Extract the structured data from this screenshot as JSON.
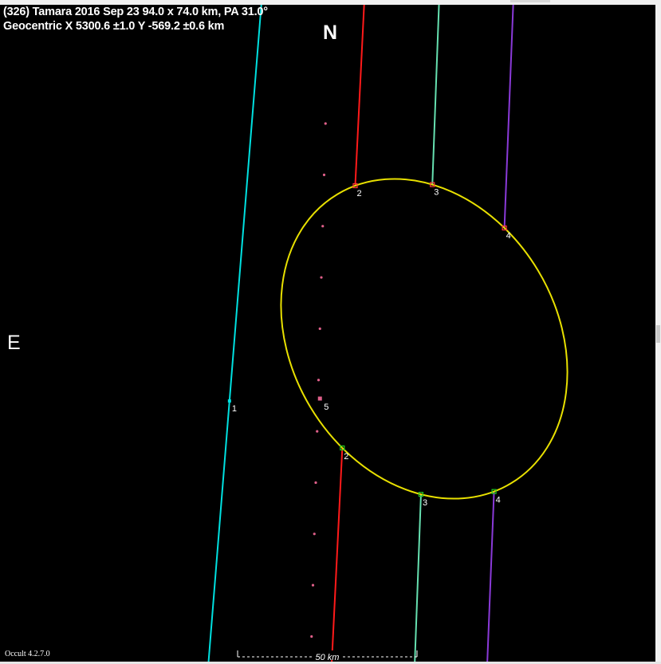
{
  "window": {
    "title": "(326) Tamara  2016 Sep 23  94.0 x 74.0 km, PA 31.0°",
    "subtitle": "Geocentric  X  5300.6 ±1.0  Y -569.2 ±0.6 km",
    "north_label": "N",
    "east_label": "E",
    "version": "Occult 4.2.7.0"
  },
  "colors": {
    "background": "#000000",
    "ellipse": "#e8e000",
    "chord1": "#00e0e0",
    "chord2": "#ff1a1a",
    "chord3": "#66e0b0",
    "chord4": "#8a3ad8",
    "miss_dots": "#e0608a",
    "disappear_marker": "#ff3a3a",
    "reappear_marker": "#22cc22",
    "scale_bar": "#ffffff"
  },
  "chart_data": {
    "type": "scatter",
    "title": "(326) Tamara  2016 Sep 23  94.0 x 74.0 km, PA 31.0°",
    "xlabel": "",
    "ylabel": "",
    "profile_ellipse": {
      "major_axis_km": 94.0,
      "minor_axis_km": 74.0,
      "position_angle_deg": 31.0
    },
    "center_km": {
      "x": 5300.6,
      "x_err": 1.0,
      "y": -569.2,
      "y_err": 0.6
    },
    "scale_bar": {
      "length_km": 50,
      "label": "50 km"
    },
    "chords": [
      {
        "id": "1",
        "label": "1",
        "kind": "miss",
        "x_start_km": -45.0,
        "x_end_km": -60.5
      },
      {
        "id": "2",
        "label": "2",
        "kind": "positive",
        "x_start_km": -16.5,
        "x_end_km": -26.0,
        "event_labels": [
          "2",
          "2"
        ]
      },
      {
        "id": "3",
        "label": "3",
        "kind": "positive",
        "x_start_km": 4.3,
        "x_end_km": -2.8,
        "event_labels": [
          "3",
          "3"
        ]
      },
      {
        "id": "4",
        "label": "4",
        "kind": "positive",
        "x_start_km": 25.0,
        "x_end_km": 17.4,
        "event_labels": [
          "4",
          "4"
        ]
      }
    ],
    "dotted_chord": {
      "label": "5",
      "kind": "miss",
      "x_km": -27.5
    }
  }
}
